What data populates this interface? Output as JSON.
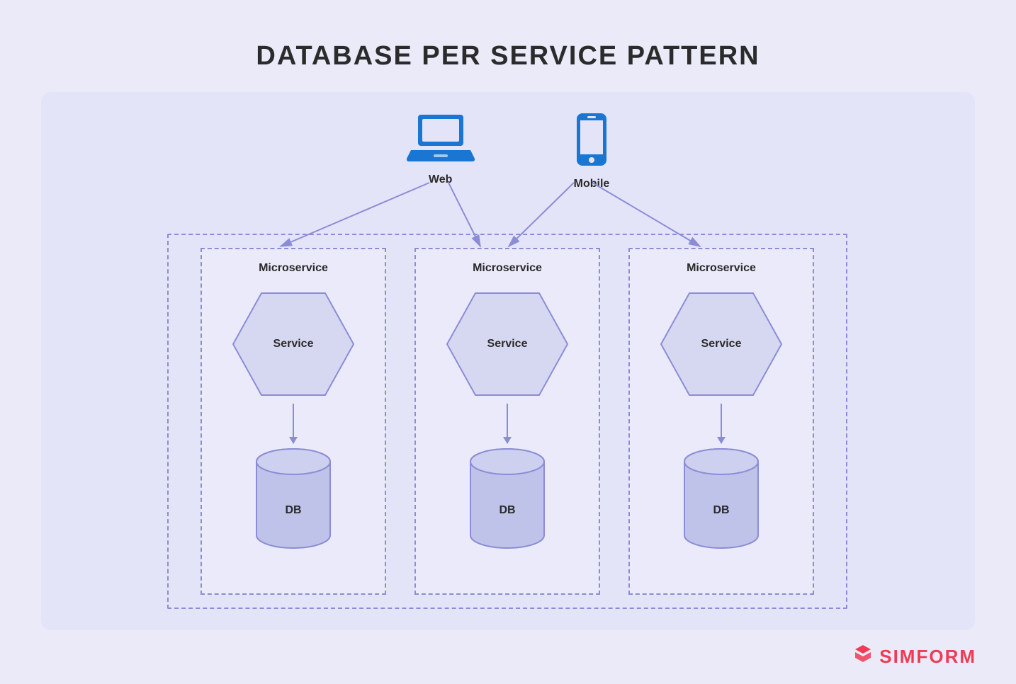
{
  "title": "DATABASE PER SERVICE PATTERN",
  "clients": {
    "web": {
      "label": "Web"
    },
    "mobile": {
      "label": "Mobile"
    }
  },
  "microservices": [
    {
      "title": "Microservice",
      "service_label": "Service",
      "db_label": "DB"
    },
    {
      "title": "Microservice",
      "service_label": "Service",
      "db_label": "DB"
    },
    {
      "title": "Microservice",
      "service_label": "Service",
      "db_label": "DB"
    }
  ],
  "brand": "SIMFORM",
  "colors": {
    "accent_blue": "#1976d2",
    "line": "#8c8cd6",
    "hex_fill": "#d6d8f1",
    "db_fill": "#bfc3ea",
    "brand": "#ef3b55"
  }
}
